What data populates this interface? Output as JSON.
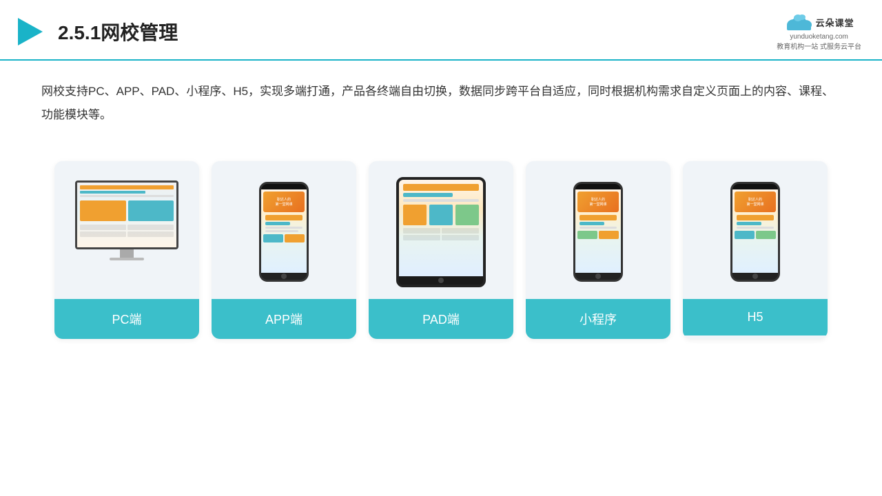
{
  "header": {
    "title": "2.5.1网校管理",
    "logo_name": "云朵课堂",
    "logo_url": "yunduoketang.com",
    "logo_sub": "教育机构一站\n式服务云平台"
  },
  "description": {
    "text": "网校支持PC、APP、PAD、小程序、H5，实现多端打通，产品各终端自由切换，数据同步跨平台自适应，同时根据机构需求自定义页面上的内容、课程、功能模块等。"
  },
  "cards": [
    {
      "id": "pc",
      "label": "PC端"
    },
    {
      "id": "app",
      "label": "APP端"
    },
    {
      "id": "pad",
      "label": "PAD端"
    },
    {
      "id": "miniapp",
      "label": "小程序"
    },
    {
      "id": "h5",
      "label": "H5"
    }
  ],
  "colors": {
    "accent": "#3bbfca",
    "header_line": "#1ab3c8",
    "card_bg": "#f0f4f8",
    "card_label_bg": "#3bbfca"
  }
}
